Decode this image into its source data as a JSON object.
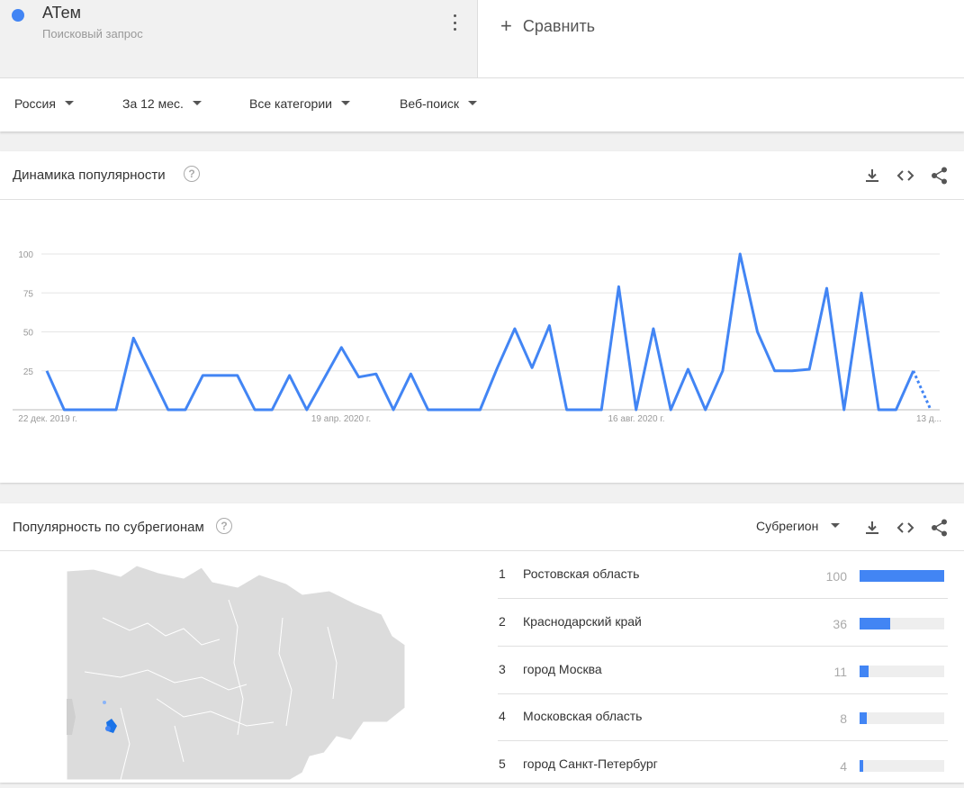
{
  "term": {
    "name": "АТем",
    "subtitle": "Поисковый запрос",
    "color": "#4285f4"
  },
  "compare_label": "Сравнить",
  "filters": [
    {
      "label": "Россия"
    },
    {
      "label": "За 12 мес."
    },
    {
      "label": "Все категории"
    },
    {
      "label": "Веб-поиск"
    }
  ],
  "trend": {
    "title": "Динамика популярности",
    "icons": [
      "download-icon",
      "embed-icon",
      "share-icon"
    ]
  },
  "chart_data": {
    "type": "line",
    "y_ticks": [
      "100",
      "75",
      "50",
      "25"
    ],
    "x_tick_labels": [
      "22 дек. 2019 г.",
      "19 апр. 2020 г.",
      "16 авг. 2020 г.",
      "13 д..."
    ],
    "ylim": [
      0,
      100
    ],
    "grid": true,
    "line_color": "#4285f4",
    "series": [
      {
        "values": [
          25,
          0,
          0,
          0,
          0,
          46,
          23,
          0,
          0,
          22,
          22,
          22,
          0,
          0,
          22,
          0,
          20,
          40,
          21,
          23,
          0,
          23,
          0,
          0,
          0,
          0,
          27,
          52,
          27,
          54,
          0,
          0,
          0,
          79,
          0,
          52,
          0,
          26,
          0,
          25,
          100,
          50,
          25,
          25,
          26,
          78,
          0,
          75,
          0,
          0,
          25,
          0
        ],
        "partial_last": true
      }
    ]
  },
  "subregions": {
    "title": "Популярность по субрегионам",
    "dropdown_label": "Субрегион",
    "items": [
      {
        "rank": "1",
        "name": "Ростовская область",
        "value": "100",
        "pct": 100
      },
      {
        "rank": "2",
        "name": "Краснодарский край",
        "value": "36",
        "pct": 36
      },
      {
        "rank": "3",
        "name": "город Москва",
        "value": "11",
        "pct": 11
      },
      {
        "rank": "4",
        "name": "Московская область",
        "value": "8",
        "pct": 8
      },
      {
        "rank": "5",
        "name": "город Санкт-Петербург",
        "value": "4",
        "pct": 4
      }
    ]
  }
}
